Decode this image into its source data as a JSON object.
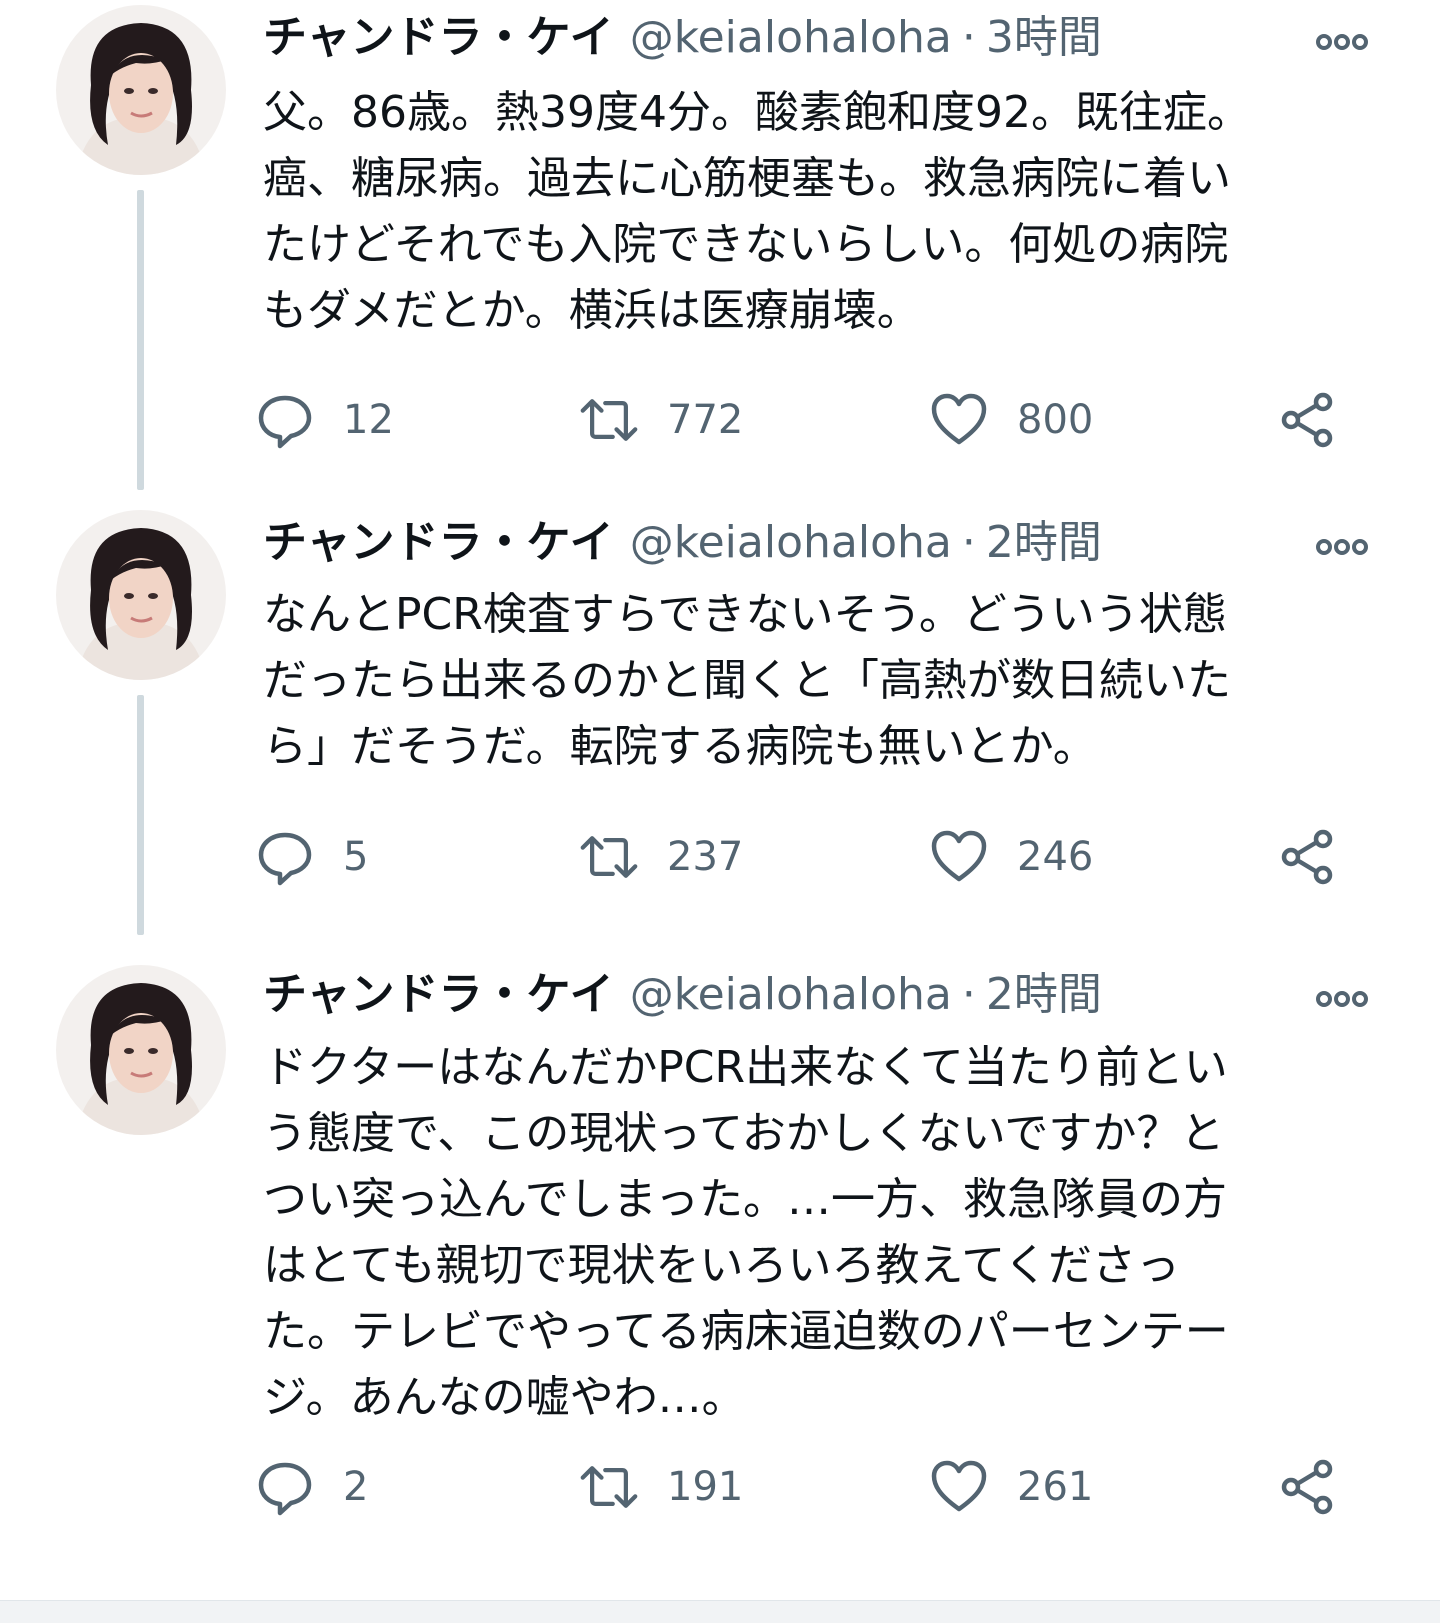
{
  "tweets": [
    {
      "display_name": "チャンドラ・ケイ",
      "handle": "@keialohaloha",
      "separator": "·",
      "time": "3時間",
      "text_lines": [
        "父。86歳。熱39度4分。酸素飽和度92。既往症。",
        "癌、糖尿病。過去に心筋梗塞も。救急病院に着い",
        "たけどそれでも入院できないらしい。何処の病院",
        "もダメだとか。横浜は医療崩壊。"
      ],
      "replies": "12",
      "retweets": "772",
      "likes": "800"
    },
    {
      "display_name": "チャンドラ・ケイ",
      "handle": "@keialohaloha",
      "separator": "·",
      "time": "2時間",
      "text_lines": [
        "なんとPCR検査すらできないそう。どういう状態",
        "だったら出来るのかと聞くと「高熱が数日続いた",
        "ら」だそうだ。転院する病院も無いとか。"
      ],
      "replies": "5",
      "retweets": "237",
      "likes": "246"
    },
    {
      "display_name": "チャンドラ・ケイ",
      "handle": "@keialohaloha",
      "separator": "·",
      "time": "2時間",
      "text_lines": [
        "ドクターはなんだかPCR出来なくて当たり前とい",
        "う態度で、この現状っておかしくないですか？と",
        "つい突っ込んでしまった。…一方、救急隊員の方",
        "はとても親切で現状をいろいろ教えてくださっ",
        "た。テレビでやってる病床逼迫数のパーセンテー",
        "ジ。あんなの嘘やわ…。"
      ],
      "replies": "2",
      "retweets": "191",
      "likes": "261"
    }
  ],
  "icons": {
    "avatar": "avatar-photo",
    "more": "more-options-icon",
    "reply": "reply-icon",
    "retweet": "retweet-icon",
    "like": "heart-icon",
    "share": "share-icon"
  },
  "colors": {
    "text": "#0f1419",
    "secondary": "#536471",
    "thread_line": "#cfd9de"
  }
}
